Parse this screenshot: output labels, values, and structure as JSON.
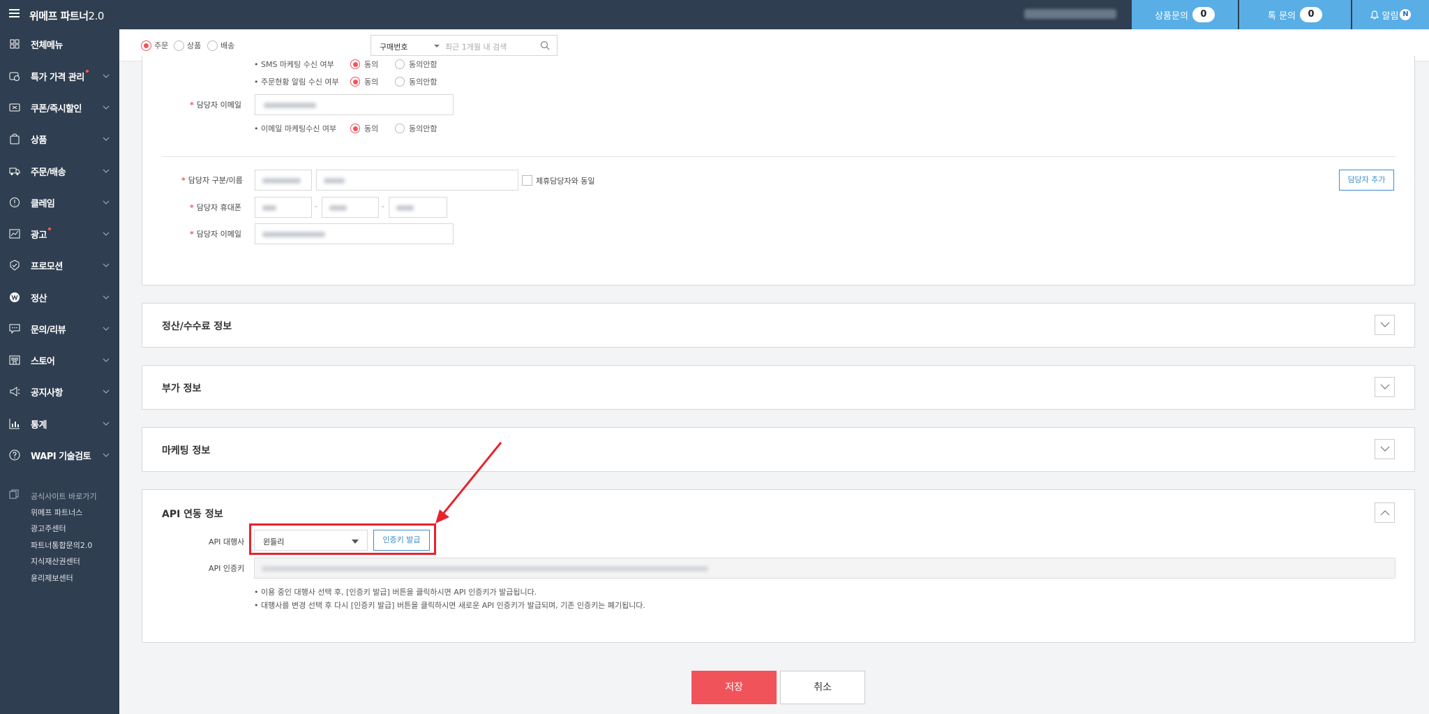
{
  "topbar": {
    "logo": "위메프 파트너",
    "logo_version": "2.0",
    "product_inquiry_label": "상품문의",
    "product_inquiry_count": "0",
    "talk_inquiry_label": "톡 문의",
    "talk_inquiry_count": "0",
    "alarm_label": "알림",
    "alarm_badge": "N"
  },
  "sidebar": {
    "items": [
      {
        "label": "전체메뉴",
        "icon": "grid-icon"
      },
      {
        "label": "특가 가격 관리",
        "icon": "price-tag-icon"
      },
      {
        "label": "쿠폰/즉시할인",
        "icon": "coupon-icon"
      },
      {
        "label": "상품",
        "icon": "bag-icon"
      },
      {
        "label": "주문/배송",
        "icon": "truck-icon"
      },
      {
        "label": "클레임",
        "icon": "claim-icon"
      },
      {
        "label": "광고",
        "icon": "chart-icon"
      },
      {
        "label": "프로모션",
        "icon": "promotion-icon"
      },
      {
        "label": "정산",
        "icon": "won-icon"
      },
      {
        "label": "문의/리뷰",
        "icon": "chat-icon"
      },
      {
        "label": "스토어",
        "icon": "store-icon"
      },
      {
        "label": "공지사항",
        "icon": "megaphone-icon"
      },
      {
        "label": "통계",
        "icon": "stats-icon"
      },
      {
        "label": "WAPI 기술검토",
        "icon": "help-icon"
      }
    ],
    "links_header": "공식사이트 바로가기",
    "links": [
      "위메프 파트너스",
      "광고주센터",
      "파트너통합문의2.0",
      "지식재산권센터",
      "윤리제보센터"
    ]
  },
  "search": {
    "options": [
      "주문",
      "상품",
      "배송"
    ],
    "selected": "주문",
    "type_select": "구매번호",
    "placeholder": "최근 1개월 내 검색"
  },
  "contact_section": {
    "sms_marketing_label": "• SMS 마케팅 수신 여부",
    "order_alert_label": "• 주문현황 알림 수신 여부",
    "email_label": "담당자 이메일",
    "email_marketing_label": "• 이메일 마케팅수신 여부",
    "agree": "동의",
    "disagree": "동의안함",
    "contact_type_label": "담당자 구분/이름",
    "same_as_partner": "제휴담당자와 동일",
    "phone_label": "담당자 휴대폰",
    "email_label_2": "담당자 이메일",
    "add_contact_button": "담당자 추가",
    "dash": "-"
  },
  "sections": {
    "settlement": "정산/수수료 정보",
    "additional": "부가 정보",
    "marketing": "마케팅 정보",
    "api": "API 연동 정보"
  },
  "api": {
    "vendor_label": "API 대행사",
    "vendor_value": "윈들리",
    "issue_key_button": "인증키 발급",
    "key_label": "API 인증키",
    "note1": "• 이용 중인 대행사 선택 후, [인증키 발급] 버튼을 클릭하시면 API 인증키가 발급됩니다.",
    "note2": "• 대행사를 변경 선택 후 다시 [인증키 발급] 버튼을 클릭하시면 새로운 API 인증키가 발급되며, 기존 인증키는 폐기됩니다."
  },
  "footer": {
    "save": "저장",
    "cancel": "취소"
  },
  "colors": {
    "nav_bg": "#2f3e50",
    "accent_blue": "#5aaee6",
    "accent_red": "#f0545a",
    "annotation_red": "#e8222c"
  }
}
